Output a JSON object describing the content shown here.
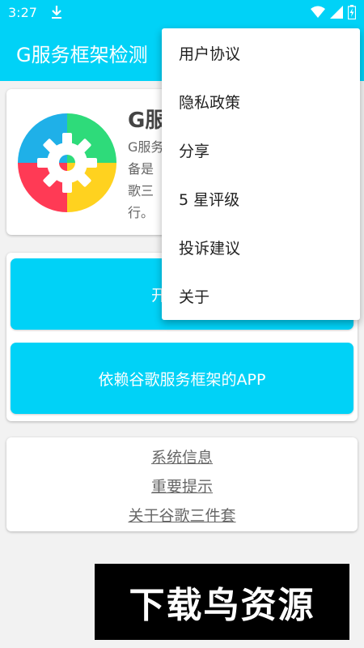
{
  "status_bar": {
    "time": "3:27",
    "icons": [
      "download-icon",
      "wifi-icon",
      "signal-icon",
      "battery-charging-icon"
    ]
  },
  "app_bar": {
    "title": "G服务框架检测"
  },
  "info_card": {
    "title": "G服",
    "description": "G服务\n备是\n歌三\n行。"
  },
  "buttons": {
    "start_check": "开始检测",
    "apps_depending": "依赖谷歌服务框架的APP"
  },
  "links": [
    "系统信息",
    "重要提示",
    "关于谷歌三件套"
  ],
  "overflow_menu": {
    "items": [
      "用户协议",
      "隐私政策",
      "分享",
      "5 星评级",
      "投诉建议",
      "关于"
    ]
  },
  "watermark": {
    "text": "下载鸟资源"
  },
  "colors": {
    "accent": "#00d2f7",
    "background": "#f2f2f2"
  }
}
